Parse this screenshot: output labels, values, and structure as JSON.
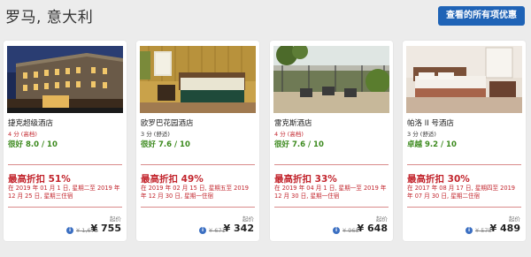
{
  "page": {
    "title": "罗马, 意大利",
    "deals_button": "查看的所有项优惠"
  },
  "hotels": [
    {
      "name": "捷克超级酒店",
      "star_num": "4 分",
      "star_kind": "(高档)",
      "rating": "很好 8.0 / 10",
      "discount": "最高折扣 51%",
      "deal": "在 2019 年 01 月 1 日, 星期二至 2019 年 12 月 25 日, 星期三住宿",
      "from": "起价",
      "old_price": "¥ 1,678",
      "new_price": "¥ 755",
      "star_color": "#c2242c"
    },
    {
      "name": "欧罗巴花园酒店",
      "star_num": "3 分",
      "star_kind": "(舒适)",
      "rating": "很好 7.6 / 10",
      "discount": "最高折扣 49%",
      "deal": "在 2019 年 02 月 15 日, 星期五至 2019 年 12 月 30 日, 星期一住宿",
      "from": "起价",
      "old_price": "¥ 671",
      "new_price": "¥ 342",
      "star_color": "#333333"
    },
    {
      "name": "雷克斯酒店",
      "star_num": "4 分",
      "star_kind": "(高档)",
      "rating": "很好 7.6 / 10",
      "discount": "最高折扣 33%",
      "deal": "在 2019 年 04 月 1 日, 星期一至 2019 年 12 月 30 日, 星期一住宿",
      "from": "起价",
      "old_price": "¥ 968",
      "new_price": "¥ 648",
      "star_color": "#c2242c"
    },
    {
      "name": "帕洛 II 号酒店",
      "star_num": "3 分",
      "star_kind": "(舒适)",
      "rating": "卓越 9.2 / 10",
      "discount": "最高折扣 30%",
      "deal": "在 2017 年 08 月 17 日, 星期四至 2019 年 07 月 30 日, 星期二住宿",
      "from": "起价",
      "old_price": "¥ 575",
      "new_price": "¥ 489",
      "star_color": "#333333"
    }
  ],
  "icons": {
    "info": "info-icon"
  },
  "colors": {
    "accent_blue": "#1f63b6",
    "discount_red": "#c2242c",
    "rating_green": "#3c8a1e",
    "background": "#ececec"
  }
}
